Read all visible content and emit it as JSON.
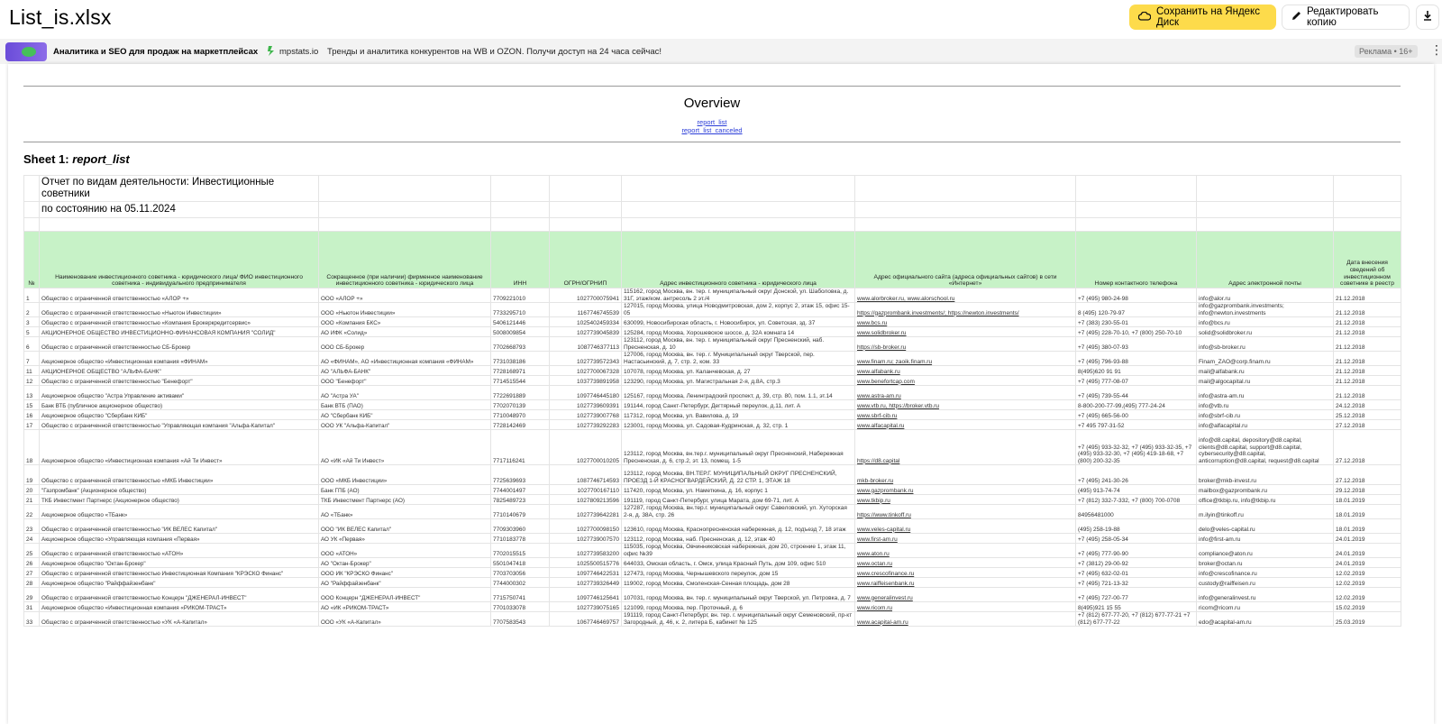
{
  "header": {
    "file_title": "List_is.xlsx",
    "save_label": "Сохранить на Яндекс Диск",
    "edit_label": "Редактировать копию"
  },
  "ad": {
    "title": "Аналитика и SEO для продаж на маркетплейсах",
    "site": "mpstats.io",
    "text": "Тренды и аналитика конкурентов на WB и OZON. Получи доступ на 24 часа сейчас!",
    "badge": "Реклама • 16+",
    "more": "⋮"
  },
  "doc": {
    "overview": "Overview",
    "links": [
      "report_list",
      "report_list_canceled"
    ],
    "sheet_prefix": "Sheet 1: ",
    "sheet_name": "report_list",
    "report_title": "Отчет по видам деятельности: Инвестиционные советники",
    "report_date": "по состоянию на 05.11.2024"
  },
  "columns": [
    "№",
    "Наименование инвестиционного советника - юридического лица/ ФИО инвестиционного советника - индивидуального предпринимателя",
    "Сокращенное (при наличии) фирменное наименование инвестиционного советника - юридического лица",
    "ИНН",
    "ОГРН/ОГРНИП",
    "Адрес инвестиционного советника - юридического лица",
    "Адрес официального сайта (адреса официальных сайтов) в сети «Интернет»",
    "Номер контактного телефона",
    "Адрес электронной почты",
    "Дата внесения сведений об инвестиционном советнике в реестр"
  ],
  "rows": [
    [
      "1",
      "Общество с ограниченной ответственностью «АЛОР +»",
      "ООО «АЛОР +»",
      "7709221010",
      "1027700075941",
      "115162, город Москва, вн. тер. г. муниципальный округ Донской, ул. Шаболовка, д. 31Г, этаж/ком. антресоль 2 эт./4",
      "www.alorbroker.ru, www.alorschool.ru",
      "+7 (495) 980-24-98",
      "info@alor.ru",
      "21.12.2018"
    ],
    [
      "2",
      "Общество с ограниченной ответственностью «Ньютон Инвестиции»",
      "ООО «Ньютон Инвестиции»",
      "7733295710",
      "1167746745539",
      "127015, город Москва, улица Новодмитровская, дом 2, корпус 2, этаж 15, офис 15-05",
      "https://gazprombank.investments/; https://newton.investments/",
      "8 (495) 120-79-97",
      "info@gazprombank.investments; info@newton.investments",
      "21.12.2018"
    ],
    [
      "3",
      "Общество с ограниченной ответственностью «Компания Брокеркредитсервис»",
      "ООО «Компания БКС»",
      "5406121446",
      "1025402459334",
      "630099, Новосибирская область, г. Новосибирск, ул. Советская, зд. 37",
      "www.bcs.ru",
      "+7 (383) 230-55-01",
      "info@bcs.ru",
      "21.12.2018"
    ],
    [
      "5",
      "АКЦИОНЕРНОЕ ОБЩЕСТВО ИНВЕСТИЦИОННО-ФИНАНСОВАЯ КОМПАНИЯ \"СОЛИД\"",
      "АО ИФК «Солид»",
      "5008009854",
      "1027739045839",
      "125284, город Москва, Хорошевское шоссе, д. 32А комната 14",
      "www.solidbroker.ru",
      "+7 (495) 228-70-10, +7 (800) 250-70-10",
      "solid@solidbroker.ru",
      "21.12.2018"
    ],
    [
      "6",
      "Общество с ограниченной ответственностью СБ-Брокер",
      "ООО СБ-Брокер",
      "7702668793",
      "1087746377113",
      "123112, город Москва, вн. тер. г. муниципальный округ Пресненский, наб. Пресненская, д. 10",
      "https://sb-broker.ru",
      "+7 (495) 380-07-93",
      "info@sb-broker.ru",
      "21.12.2018"
    ],
    [
      "7",
      "Акционерное общество «Инвестиционная компания «ФИНАМ»",
      "АО «ФИНАМ», АО «Инвестиционная компания «ФИНАМ»",
      "7731038186",
      "1027739572343",
      "127006, город Москва, вн. тер. г. Муниципальный округ Тверской, пер. Настасьинский, д. 7, стр. 2, ком. 33",
      "www.finam.ru; zaoik.finam.ru",
      "+7 (495) 796-93-88",
      "Finam_ZAO@corp.finam.ru",
      "21.12.2018"
    ],
    [
      "11",
      "АКЦИОНЕРНОЕ ОБЩЕСТВО \"АЛЬФА-БАНК\"",
      "АО \"АЛЬФА-БАНК\"",
      "7728168971",
      "1027700067328",
      "107078, город Москва, ул. Каланчевская, д. 27",
      "www.alfabank.ru",
      "8(495)620 91 91",
      "mail@alfabank.ru",
      "21.12.2018"
    ],
    [
      "12",
      "Общество с ограниченной ответственностью \"Бенефорт\"",
      "ООО \"Бенефорт\"",
      "7714515544",
      "1037739891958",
      "123290, город Москва, ул. Магистральная 2-я, д.8А, стр.3",
      "www.benefortcap.com",
      "+7 (495) 777-08-07",
      "mail@algocapital.ru",
      "21.12.2018"
    ],
    [
      "13",
      "Акционерное общество \"Астра Управление активами\"",
      "АО \"Астра УА\"",
      "7722691889",
      "1097746445180",
      "125167, город Москва, Ленинградский проспект, д. 39, стр. 80, пом. 1.1, эт.14",
      "www.astra-am.ru",
      "+7 (495) 739-55-44",
      "info@astra-am.ru",
      "21.12.2018"
    ],
    [
      "15",
      "Банк ВТБ (публичное акционерное общество)",
      "Банк ВТБ (ПАО)",
      "7702070139",
      "1027739609391",
      "191144, город Санкт-Петербург, Дегтярный переулок, д.11, лит. А",
      "www.vtb.ru, https://broker.vtb.ru",
      "8-800-200-77-99,(495) 777-24-24",
      "info@vtb.ru",
      "24.12.2018"
    ],
    [
      "16",
      "Акционерное общество \"Сбербанк КИБ\"",
      "АО \"Сбербанк КИБ\"",
      "7710048970",
      "1027739007768",
      "117312, город Москва, ул. Вавилова, д. 19",
      "www.sbrf-cib.ru",
      "+7 (495) 665-56-00",
      "info@sbrf-cib.ru",
      "25.12.2018"
    ],
    [
      "17",
      "Общество с ограниченной ответственностью \"Управляющая компания \"Альфа-Капитал\"",
      "ООО УК \"Альфа-Капитал\"",
      "7728142469",
      "1027739292283",
      "123001, город Москва, ул. Садовая-Кудринская, д. 32, стр. 1",
      "www.alfacapital.ru",
      "+7 495 797-31-52",
      "info@alfacapital.ru",
      "27.12.2018"
    ],
    [
      "18",
      "Акционерное общество «Инвестиционная компания «Ай Ти Инвест»",
      "АО «ИК «Ай Ти Инвест»",
      "7717116241",
      "1027700010205",
      "123112, город Москва, вн.тер.г. муниципальный округ Пресненский, Набережная Пресненская, д. 6, стр.2, эт. 13, помещ. 1-5",
      "https://d8.capital",
      "+7 (495) 933-32-32, +7 (495) 933-32-35, +7 (495) 933-32-30, +7 (495) 419-18-68, +7 (800) 200-32-35",
      "info@d8.capital, depository@d8.capital, clients@d8.capital, support@d8.capital, cybersecurity@d8.capital, anticorruption@d8.capital, request@d8.capital",
      "27.12.2018"
    ],
    [
      "19",
      "Общество с ограниченной ответственностью «МКБ Инвестиции»",
      "ООО «МКБ Инвестиции»",
      "7725639693",
      "1087746714593",
      "123112, город Москва, ВН.ТЕР.Г. МУНИЦИПАЛЬНЫЙ ОКРУГ ПРЕСНЕНСКИЙ, ПРОЕЗД 1-Й КРАСНОГВАРДЕЙСКИЙ, Д. 22 СТР. 1, ЭТАЖ 18",
      "mkb-broker.ru",
      "+7 (495) 241-30-26",
      "broker@mkb-invest.ru",
      "27.12.2018"
    ],
    [
      "20",
      "\"Газпромбанк\" (Акционерное общество)",
      "Банк ГПБ (АО)",
      "7744001497",
      "1027700167110",
      "117420, город Москва, ул. Наметкина, д. 16, корпус 1",
      "www.gazprombank.ru",
      "(495) 913-74-74",
      "mailbox@gazprombank.ru",
      "29.12.2018"
    ],
    [
      "21",
      "ТКБ Инвестмент Партнерс (Акционерное общество)",
      "ТКБ Инвестмент Партнерс (АО)",
      "7825489723",
      "1027809213596",
      "191119, город Санкт-Петербург, улица Марата, дом 69-71, лит. А",
      "www.tkbip.ru",
      "+7 (812) 332-7-332, +7 (800) 700-0708",
      "office@tkbip.ru, info@tkbip.ru",
      "18.01.2019"
    ],
    [
      "22",
      "Акционерное общество «ТБанк»",
      "АО «ТБанк»",
      "7710140679",
      "1027739642281",
      "127287, город Москва, вн.тер.г. муниципальный округ Савеловский, ул. Хуторская 2-я, д. 38А, стр. 26",
      "https://www.tinkoff.ru",
      "84956481000",
      "m.ilyin@tinkoff.ru",
      "18.01.2019"
    ],
    [
      "23",
      "Общество с ограниченной ответственностью \"ИК ВЕЛЕС Капитал\"",
      "ООО \"ИК ВЕЛЕС Капитал\"",
      "7709303960",
      "1027700098150",
      "123610, город Москва, Краснопресненская набережная, д. 12, подъезд 7, 18 этаж",
      "www.veles-capital.ru",
      "(495) 258-19-88",
      "delo@veles-capital.ru",
      "18.01.2019"
    ],
    [
      "24",
      "Акционерное общество «Управляющая компания «Первая»",
      "АО УК «Первая»",
      "7710183778",
      "1027739007570",
      "123112, город Москва, наб. Пресненская, д. 12, этаж 40",
      "www.first-am.ru",
      "+7 (495) 258-05-34",
      "info@first-am.ru",
      "24.01.2019"
    ],
    [
      "25",
      "Общество с ограниченной ответственностью «АТОН»",
      "ООО «АТОН»",
      "7702015515",
      "1027739583200",
      "115035, город Москва, Овчинниковская набережная, дом 20, строение 1, этаж 11, офис №39",
      "www.aton.ru",
      "+7 (495) 777-90-90",
      "compliance@aton.ru",
      "24.01.2019"
    ],
    [
      "26",
      "Акционерное общество \"Октан-Брокер\"",
      "АО \"Октан-Брокер\"",
      "5501047418",
      "1025500515776",
      "644033, Омская область, г. Омск, улица Красный Путь, дом 109, офис 510",
      "www.octan.ru",
      "+7 (3812) 29-00-92",
      "broker@octan.ru",
      "24.01.2019"
    ],
    [
      "27",
      "Общество с ограниченной ответственностью Инвестиционная Компания \"КРЭСКО Финанс\"",
      "ООО ИК \"КРЭСКО Финанс\"",
      "7703703056",
      "1097746422531",
      "127473, город Москва, Чернышевского переулок, дом 15",
      "www.crescofinance.ru",
      "+7 (495) 632-02-01",
      "info@crescofinance.ru",
      "12.02.2019"
    ],
    [
      "28",
      "Акционерное общество \"Райффайзенбанк\"",
      "АО \"Райффайзенбанк\"",
      "7744000302",
      "1027739326449",
      "119002, город Москва, Смоленская-Сенная площадь, дом 28",
      "www.raiffeisenbank.ru",
      "+7 (495) 721-13-32",
      "custody@raiffeisen.ru",
      "12.02.2019"
    ],
    [
      "29",
      "Общество с ограниченной ответственностью Концерн \"ДЖЕНЕРАЛ-ИНВЕСТ\"",
      "ООО Концерн \"ДЖЕНЕРАЛ-ИНВЕСТ\"",
      "7715750741",
      "1097746125641",
      "107031, город Москва, вн. тер. г. муниципальный округ Тверской, ул. Петровка, д. 7",
      "www.generalinvest.ru",
      "+7 (495) 727-00-77",
      "info@generalinvest.ru",
      "12.02.2019"
    ],
    [
      "31",
      "Акционерное общество «Инвестиционная компания «РИКОМ-ТРАСТ»",
      "АО «ИК «РИКОМ-ТРАСТ»",
      "7701033078",
      "1027739075165",
      "121099, город Москва, пер. Проточный, д. 6",
      "www.ricom.ru",
      "8(495)921 15 55",
      "ricom@ricom.ru",
      "15.02.2019"
    ],
    [
      "33",
      "Общество с ограниченной ответственностью «УК «А-Капитал»",
      "ООО «УК «А-Капитал»",
      "7707583543",
      "1067746469757",
      "191119, город Санкт-Петербург, вн. тер. г. муниципальный округ Семеновский, пр-кт Загородный, д. 46, к. 2, литера Б, кабинет № 125",
      "www.acapital-am.ru",
      "+7 (812) 677-77-20, +7 (812) 677-77-21 +7 (812) 677-77-22",
      "edo@acapital-am.ru",
      "25.03.2019"
    ]
  ]
}
